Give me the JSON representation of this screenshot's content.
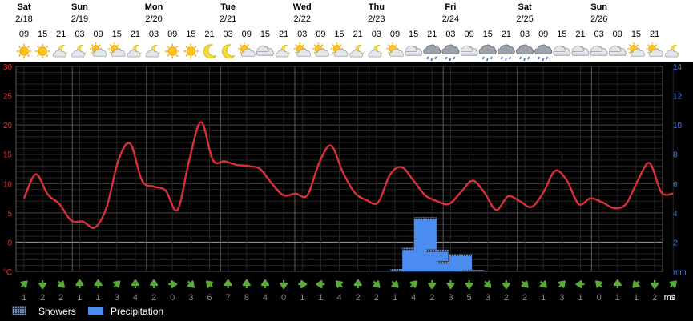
{
  "days": [
    {
      "name": "Sat",
      "date": "2/18"
    },
    {
      "name": "Sun",
      "date": "2/19"
    },
    {
      "name": "Mon",
      "date": "2/20"
    },
    {
      "name": "Tue",
      "date": "2/21"
    },
    {
      "name": "Wed",
      "date": "2/22"
    },
    {
      "name": "Thu",
      "date": "2/23"
    },
    {
      "name": "Fri",
      "date": "2/24"
    },
    {
      "name": "Sat",
      "date": "2/25"
    },
    {
      "name": "Sun",
      "date": "2/26"
    }
  ],
  "hours": [
    "09",
    "15",
    "21",
    "03",
    "09",
    "15",
    "21",
    "03",
    "09",
    "15",
    "21",
    "03",
    "09",
    "15",
    "21",
    "03",
    "09",
    "15",
    "21",
    "03",
    "09",
    "15",
    "21",
    "03",
    "09",
    "15",
    "21",
    "03",
    "09",
    "15",
    "21",
    "03",
    "09",
    "15",
    "21"
  ],
  "icons": [
    "sun-icon",
    "sun-icon",
    "moon-cloud-icon",
    "moon-cloud-icon",
    "sun-cloud-icon",
    "sun-cloud-icon",
    "moon-cloud-icon",
    "moon-cloud-icon",
    "sun-icon",
    "sun-icon",
    "moon-icon",
    "moon-icon",
    "sun-cloud-icon",
    "cloud-icon",
    "moon-cloud-icon",
    "sun-cloud-icon",
    "sun-cloud-icon",
    "sun-cloud-icon",
    "moon-cloud-icon",
    "moon-cloud-icon",
    "sun-cloud-icon",
    "cloud-icon",
    "rain-cloud-icon",
    "rain-cloud-icon",
    "cloud-icon",
    "rain-cloud-icon",
    "rain-cloud-icon",
    "rain-cloud-icon",
    "rain-cloud-icon",
    "cloud-icon",
    "cloud-icon",
    "cloud-icon",
    "cloud-icon",
    "sun-cloud-icon",
    "sun-cloud-icon",
    "moon-cloud-icon"
  ],
  "colors": {
    "temperature": "#d9303c",
    "precipitation": "#4a8cf0",
    "left_axis": "#e03030",
    "right_axis": "#3a7cf0",
    "wind_arrow": "#5aaa38"
  },
  "chart_data": {
    "type": "line",
    "series": [
      {
        "values": [
          7.5,
          11.6,
          8.2,
          6.5,
          3.7,
          3.5,
          2.5,
          6.0,
          14.0,
          16.8,
          10.5,
          9.5,
          8.8,
          5.5,
          14.0,
          20.5,
          14.0,
          13.8,
          13.2,
          13.0,
          12.5,
          10.0,
          8.0,
          8.3,
          8.0,
          13.5,
          16.5,
          12.0,
          8.5,
          7.2,
          6.8,
          11.5,
          12.8,
          10.5,
          8.0,
          7.0,
          6.5,
          8.5,
          10.5,
          8.5,
          5.5,
          7.8,
          7.0,
          6.0,
          8.5,
          12.2,
          10.5,
          6.5,
          7.5,
          6.8,
          5.8,
          6.5,
          10.5,
          13.5,
          8.5,
          8.3
        ]
      },
      {
        "values": [
          0,
          0,
          0,
          0,
          0,
          0,
          0,
          0,
          0,
          0,
          0,
          0,
          0,
          0,
          0,
          0,
          0,
          0,
          0,
          0,
          0,
          0,
          0,
          0,
          0,
          0,
          0,
          0,
          0,
          0,
          0,
          0.05,
          0.15,
          1.6,
          3.7,
          1.5,
          0.7,
          1.2,
          0.1,
          0,
          0,
          0,
          0,
          0,
          0,
          0,
          0,
          0,
          0,
          0,
          0,
          0,
          0,
          0,
          0,
          0
        ]
      }
    ],
    "temp_ylim": [
      -5,
      30
    ],
    "temp_yticks": [
      "°C",
      "0",
      "5",
      "10",
      "15",
      "20",
      "25",
      "30"
    ],
    "precip_ylim": [
      0,
      14
    ],
    "precip_yticks": [
      "mm",
      "2",
      "4",
      "6",
      "8",
      "10",
      "12",
      "14"
    ],
    "grid": true,
    "wind": {
      "arrows": [
        "up-right",
        "down",
        "down-right",
        "up",
        "up",
        "up-right",
        "up",
        "up",
        "right",
        "down-right",
        "up-left",
        "up",
        "up",
        "up",
        "down",
        "right",
        "left",
        "up-left",
        "up",
        "down-right",
        "down-right",
        "up-right",
        "down",
        "down",
        "down",
        "down-right",
        "down",
        "down-right",
        "down-right",
        "up-right",
        "left",
        "up-left",
        "up",
        "down-left",
        "down",
        "up-right"
      ],
      "speeds": [
        "1",
        "2",
        "2",
        "1",
        "1",
        "3",
        "4",
        "2",
        "0",
        "3",
        "6",
        "7",
        "8",
        "4",
        "0",
        "1",
        "1",
        "4",
        "2",
        "2",
        "1",
        "4",
        "2",
        "3",
        "5",
        "3",
        "2",
        "2",
        "1",
        "3",
        "1",
        "0",
        "1",
        "1",
        "2",
        "2"
      ],
      "unit": "ms"
    },
    "legend": [
      {
        "name": "Showers",
        "kind": "hatched"
      },
      {
        "name": "Precipitation",
        "kind": "solid"
      }
    ]
  }
}
